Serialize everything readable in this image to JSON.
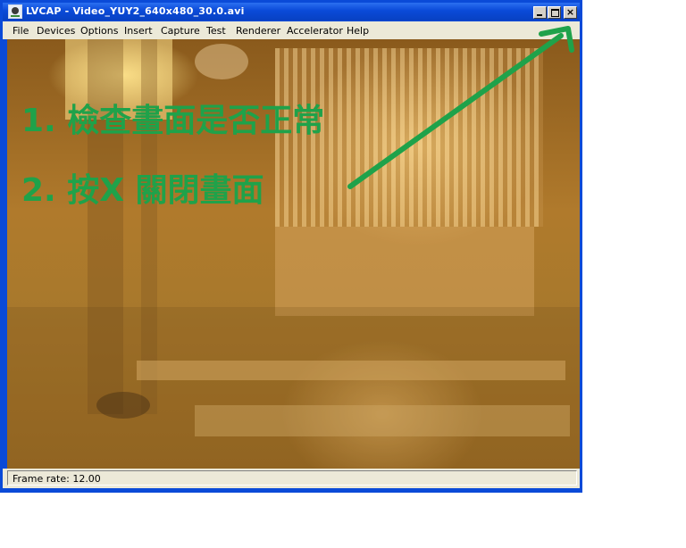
{
  "window": {
    "title": "LVCAP - Video_YUY2_640x480_30.0.avi",
    "icon": "logitech-app-icon",
    "controls": {
      "minimize": "minimize-icon",
      "maximize": "maximize-icon",
      "close": "×"
    }
  },
  "menu": {
    "items": [
      "File",
      "Devices",
      "Options",
      "Insert",
      "Capture",
      "Test",
      "Renderer",
      "Accelerator",
      "Help"
    ]
  },
  "overlay": {
    "step1": "1. 檢查畫面是否正常",
    "step2": "2. 按X 關閉畫面",
    "color": "#1fa24a"
  },
  "status": {
    "frame_rate": "Frame rate: 12.00"
  }
}
